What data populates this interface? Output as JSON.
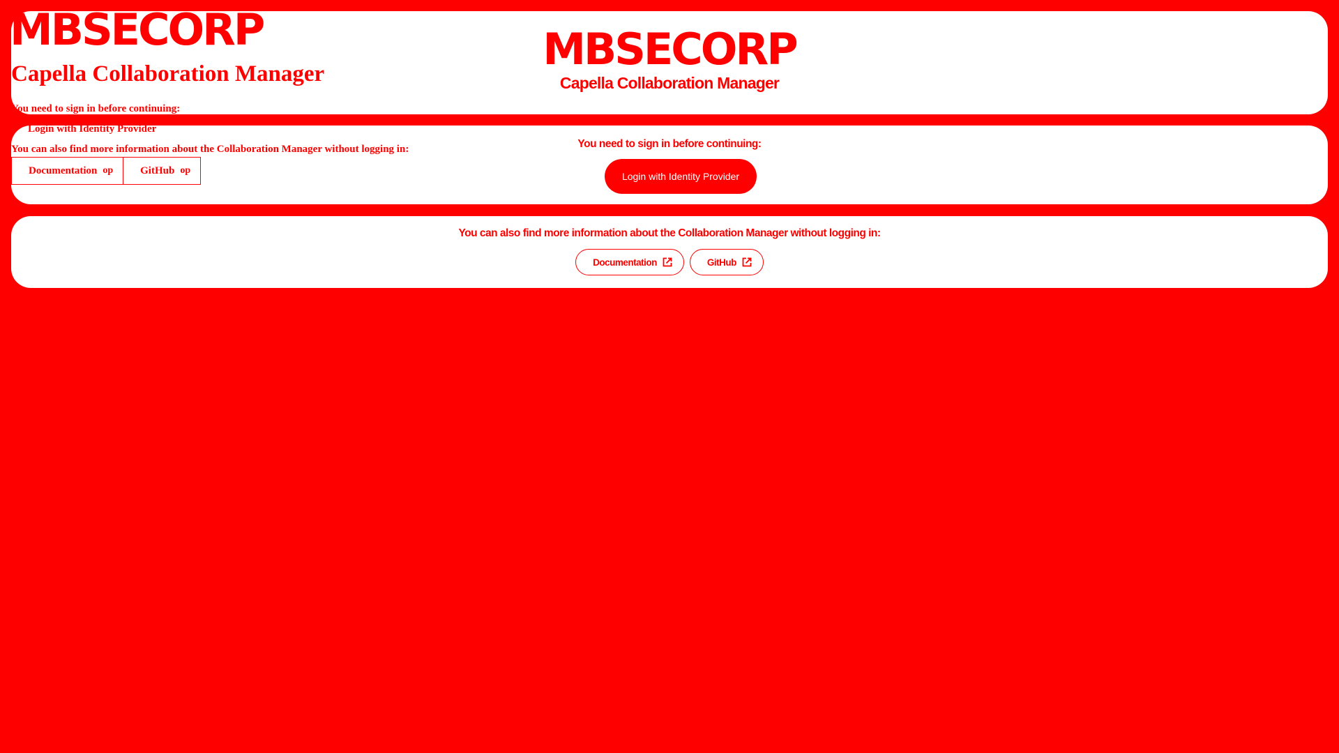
{
  "colors": {
    "page_background": "#ff0000",
    "card_background": "#ffffff",
    "accent": "#ff0000",
    "button_text": "#ffffff"
  },
  "header": {
    "logo_text": "MBSECORP",
    "app_title": "Capella Collaboration Manager"
  },
  "login": {
    "message": "You need to sign in before continuing:",
    "button_label": "Login with Identity Provider"
  },
  "info": {
    "message": "You can also find more information about the Collaboration Manager without logging in:",
    "links": [
      {
        "label": "Documentation",
        "icon": "open-in-new-icon",
        "icon_ligature": "op"
      },
      {
        "label": "GitHub",
        "icon": "open-in-new-icon",
        "icon_ligature": "op"
      }
    ]
  }
}
